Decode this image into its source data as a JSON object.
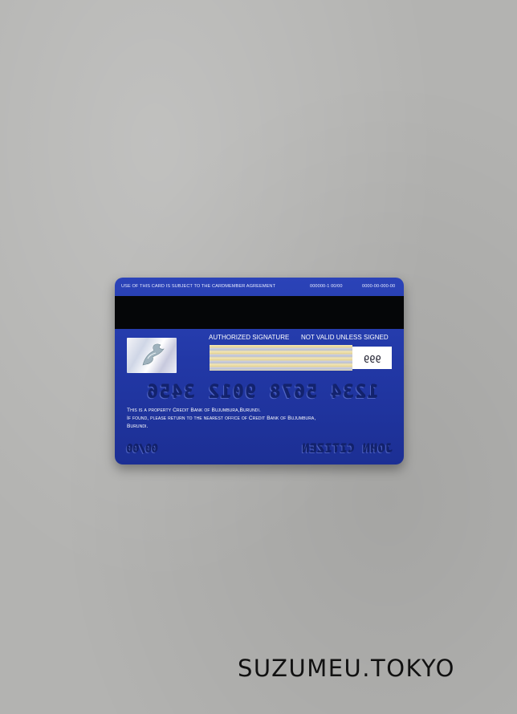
{
  "card": {
    "top_notice": "USE OF THIS CARD IS SUBJECT TO THE CARDMEMBER AGREEMENT",
    "top_code_1": "000000-1 00/00",
    "top_code_2": "0000-00-000-00",
    "signature_label": "AUTHORIZED SIGNATURE",
    "not_valid_label": "NOT VALID UNLESS SIGNED",
    "cvv": "999",
    "card_number": "1234 5678 9012 3456",
    "property_line_1": "This is a property Credit Bank of Bujumbura,Burundi.",
    "property_line_2": "If found, please return to the nearest office of Credit Bank of Bujumbura,",
    "property_line_3": "Burundi.",
    "expiry": "00/00",
    "holder_name": "JOHN CITIZEN",
    "colors": {
      "card_blue": "#2238a6",
      "embossed": "#13236e",
      "stripe": "#050608"
    },
    "icons": {
      "hologram": "dove-hologram-icon"
    }
  },
  "watermark": "SUZUMEU.TOKYO"
}
